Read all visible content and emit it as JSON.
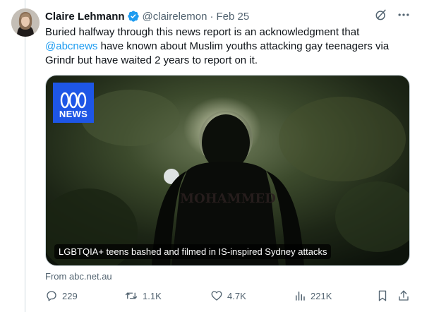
{
  "tweet": {
    "author": {
      "display_name": "Claire Lehmann",
      "handle": "@clairelemon",
      "verified": true
    },
    "separator": "·",
    "date": "Feb 25",
    "text_before_mention": "Buried halfway through this news report is an acknowledgment that ",
    "mention": "@abcnews",
    "text_after_mention": " have known about Muslim youths attacking gay teenagers via Grindr but have waited 2 years to report on it.",
    "media": {
      "logo_text": "NEWS",
      "caption": "LGBTQIA+ teens bashed and filmed in IS-inspired Sydney attacks"
    },
    "source": "From abc.net.au",
    "actions": {
      "replies": "229",
      "reposts": "1.1K",
      "likes": "4.7K",
      "views": "221K"
    }
  },
  "colors": {
    "accent": "#1d9bf0",
    "secondary_text": "#536471",
    "abc_blue": "#1e56e6"
  },
  "icons": [
    "verified-badge-icon",
    "grok-icon",
    "more-icon",
    "reply-icon",
    "repost-icon",
    "like-icon",
    "views-icon",
    "bookmark-icon",
    "share-icon"
  ]
}
